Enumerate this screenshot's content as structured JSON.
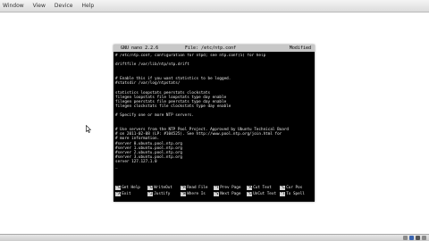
{
  "menubar": {
    "items": [
      "Window",
      "View",
      "Device",
      "Help"
    ]
  },
  "nano": {
    "version": "GNU nano 2.2.6",
    "file": "File: /etc/ntp.conf",
    "status": "Modified",
    "lines": [
      "# /etc/ntp.conf, configuration for ntpd; see ntp.conf(5) for help",
      "",
      "driftfile /var/lib/ntp/ntp.drift",
      "",
      "",
      "# Enable this if you want statistics to be logged.",
      "#statsdir /var/log/ntpstats/",
      "",
      "statistics loopstats peerstats clockstats",
      "filegen loopstats file loopstats type day enable",
      "filegen peerstats file peerstats type day enable",
      "filegen clockstats file clockstats type day enable",
      "",
      "# Specify one or more NTP servers.",
      "",
      "",
      "# Use servers from the NTP Pool Project. Approved by Ubuntu Technical Board",
      "# on 2011-02-08 (LP: #104525). See http://www.pool.ntp.org/join.html for",
      "# more information.",
      "#server 0.ubuntu.pool.ntp.org",
      "#server 1.ubuntu.pool.ntp.org",
      "#server 2.ubuntu.pool.ntp.org",
      "#server 3.ubuntu.pool.ntp.org",
      "server 127.127.1.0",
      "_"
    ],
    "shortcuts_row1": [
      {
        "key": "^G",
        "label": "Get Help"
      },
      {
        "key": "^O",
        "label": "WriteOut"
      },
      {
        "key": "^R",
        "label": "Read File"
      },
      {
        "key": "^Y",
        "label": "Prev Page"
      },
      {
        "key": "^K",
        "label": "Cut Text"
      },
      {
        "key": "^C",
        "label": "Cur Pos"
      }
    ],
    "shortcuts_row2": [
      {
        "key": "^X",
        "label": "Exit"
      },
      {
        "key": "^J",
        "label": "Justify"
      },
      {
        "key": "^W",
        "label": "Where Is"
      },
      {
        "key": "^V",
        "label": "Next Page"
      },
      {
        "key": "^U",
        "label": "UnCut Text"
      },
      {
        "key": "^T",
        "label": "To Spell"
      }
    ]
  },
  "colors": {
    "terminal_bg": "#000000",
    "terminal_fg": "#e8e8e8",
    "header_bg": "#c8c8c8"
  },
  "icons": [
    "mouse-pointer-icon",
    "tray-network-icon",
    "tray-disk-icon",
    "tray-usb-icon",
    "tray-display-icon"
  ]
}
